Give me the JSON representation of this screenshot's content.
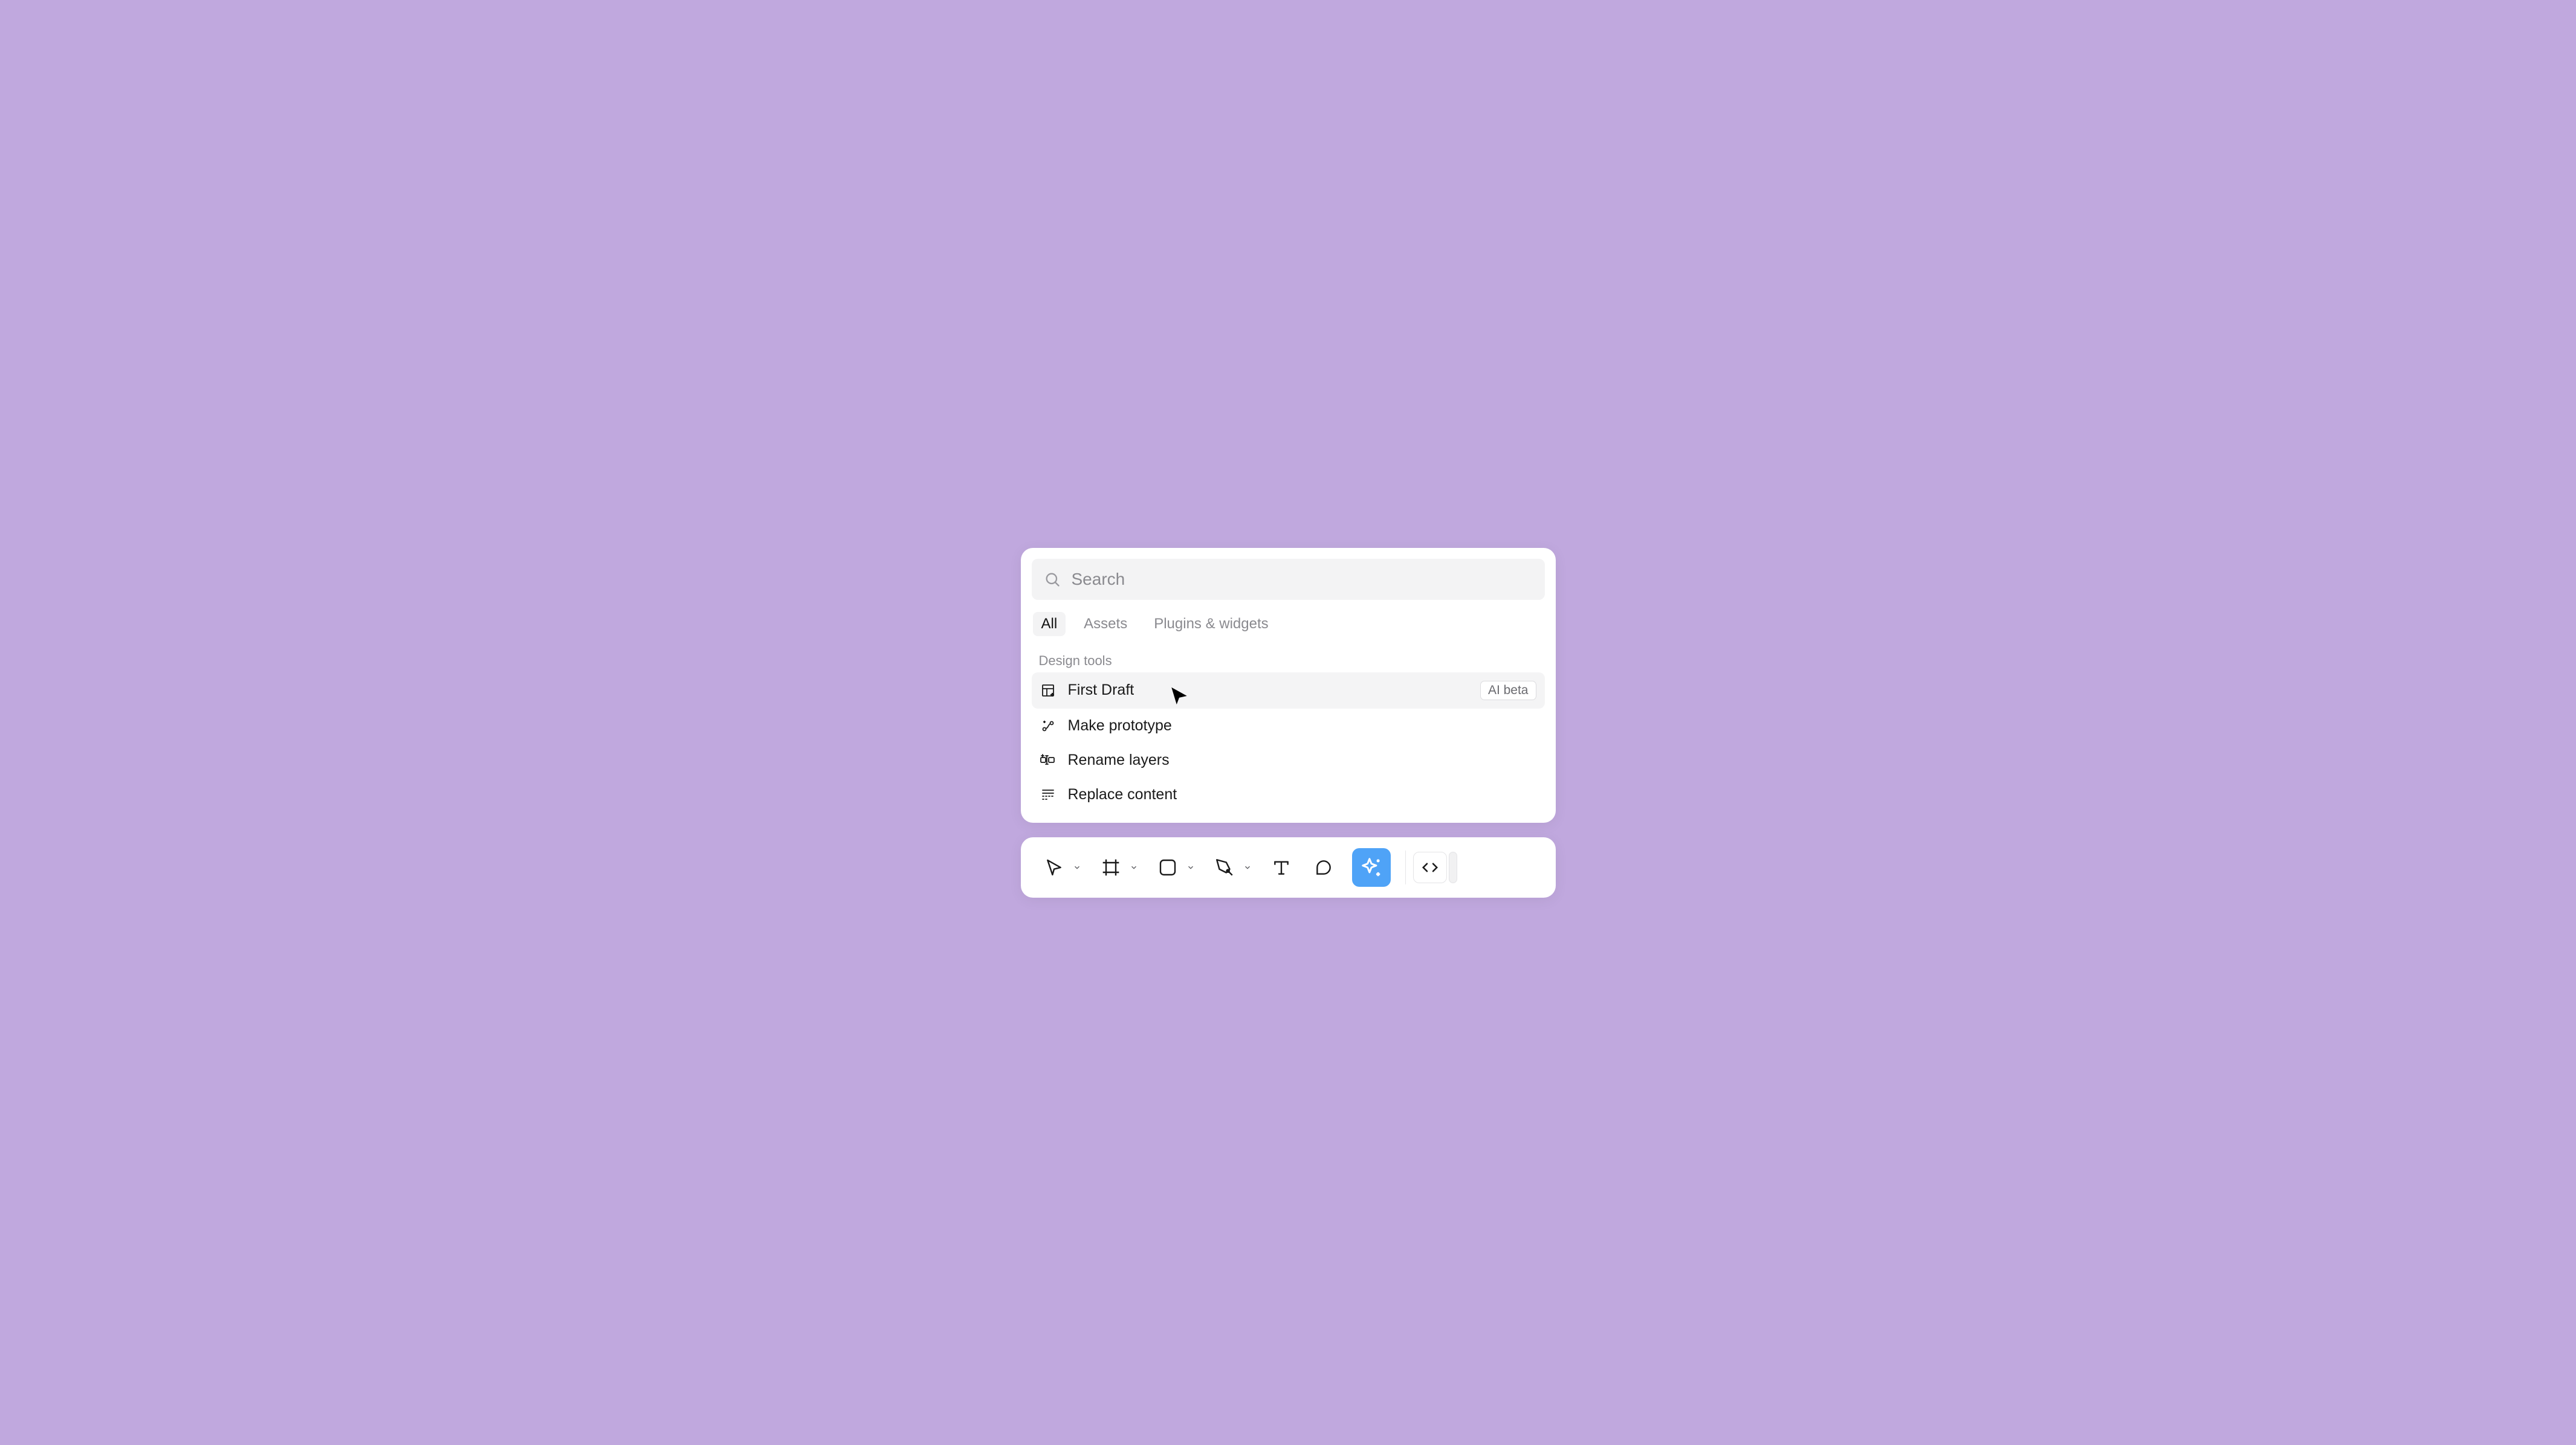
{
  "search": {
    "placeholder": "Search"
  },
  "tabs": [
    "All",
    "Assets",
    "Plugins & widgets"
  ],
  "section_header": "Design tools",
  "items": [
    {
      "label": "First Draft",
      "badge": "AI beta"
    },
    {
      "label": "Make prototype"
    },
    {
      "label": "Rename layers"
    },
    {
      "label": "Replace content"
    }
  ],
  "toolbar": {
    "tools": [
      "move",
      "frame",
      "rectangle",
      "pen",
      "text",
      "comment",
      "ai"
    ],
    "devmode": "code"
  }
}
